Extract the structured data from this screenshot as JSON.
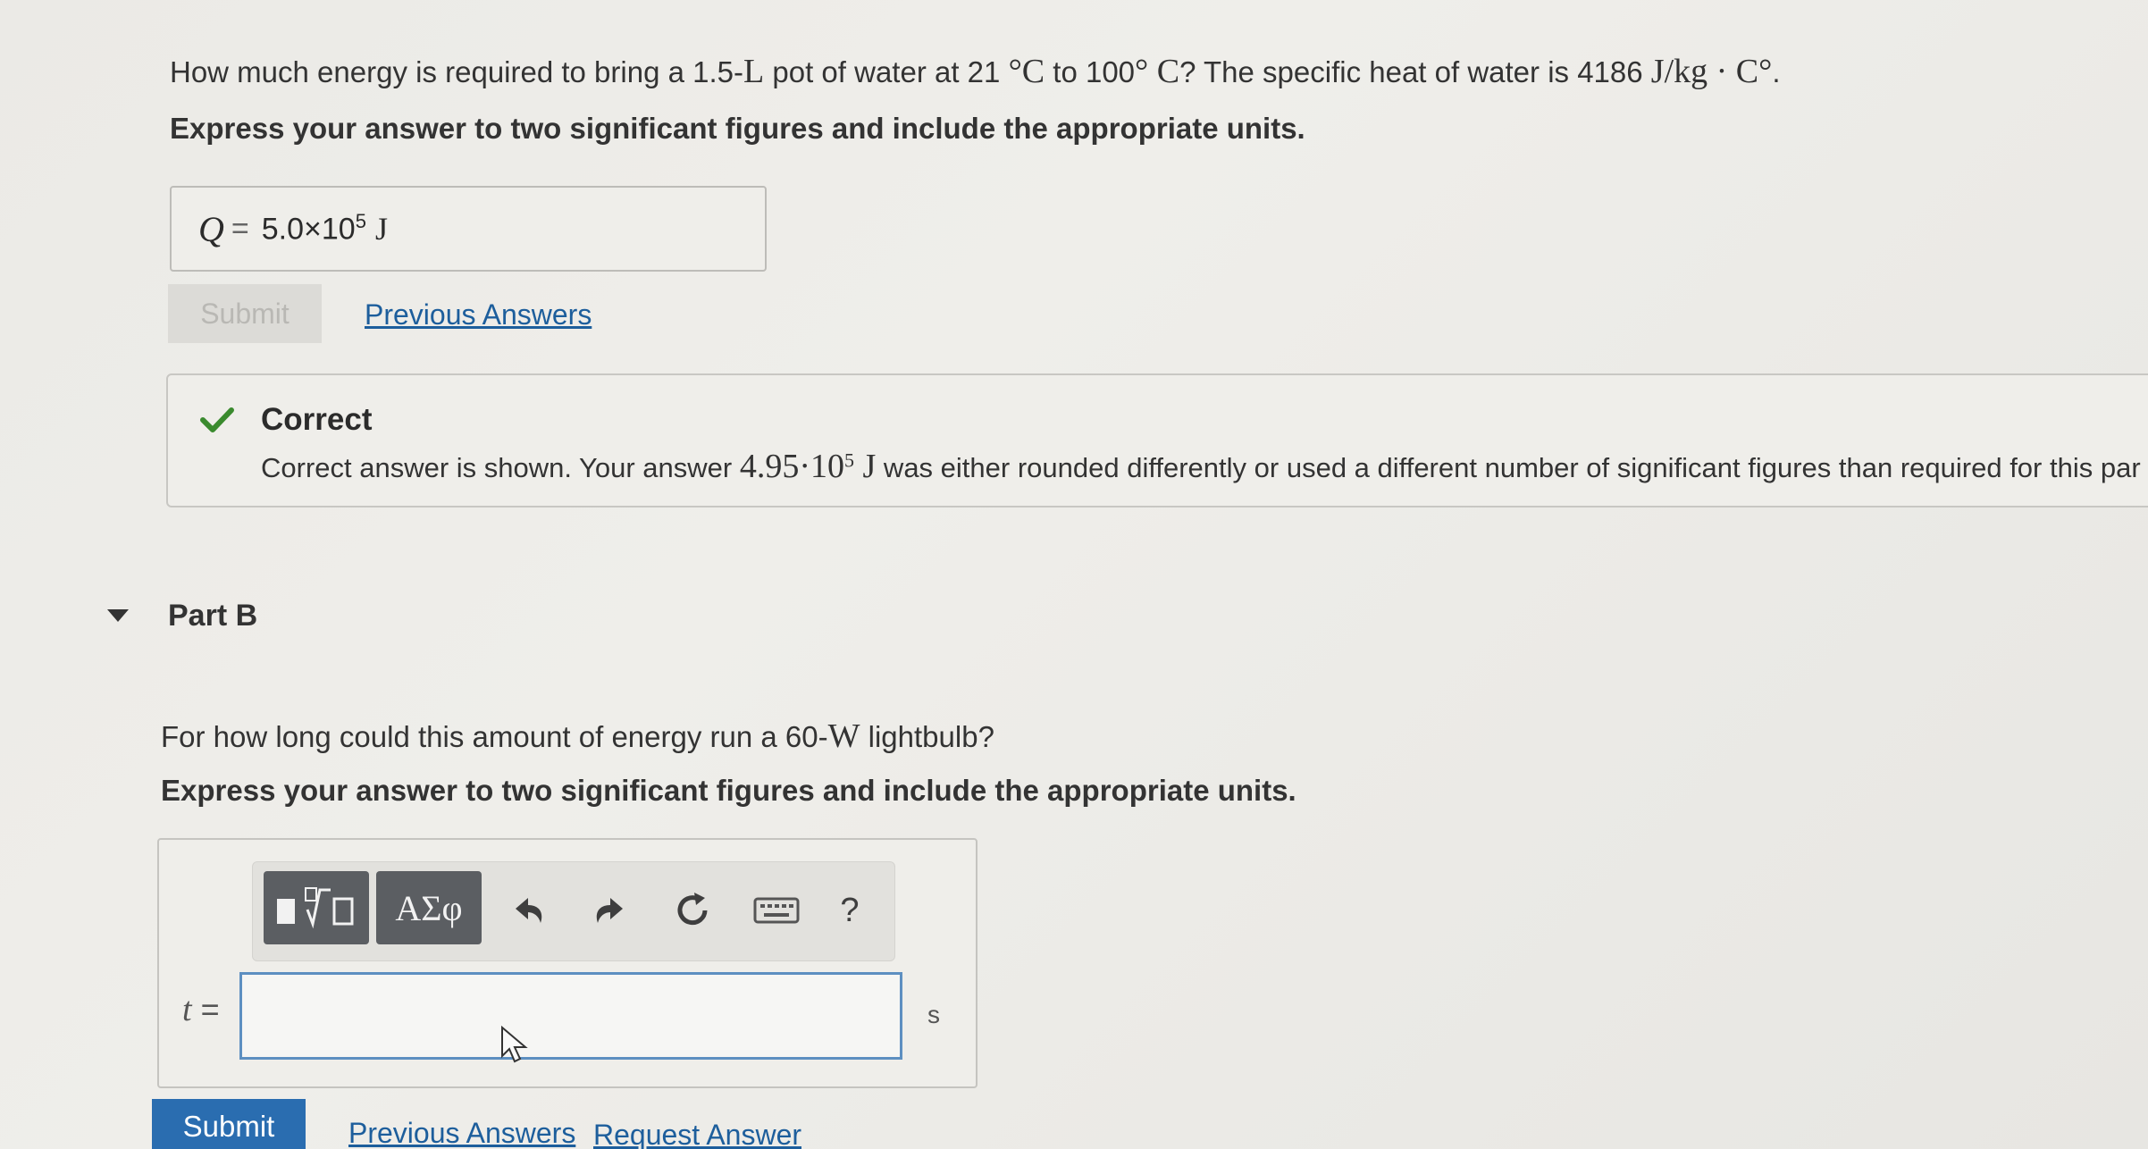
{
  "part_a": {
    "question_pre": "How much energy is required to bring a 1.5-",
    "question_L": "L",
    "question_mid1": " pot of water at 21 ",
    "question_deg1": "°C",
    "question_mid2": " to 100",
    "question_deg2": "° C",
    "question_mid3": "? The specific heat of water is 4186 ",
    "question_unit": "J/kg · C°",
    "question_end": ".",
    "instruction": "Express your answer to two significant figures and include the appropriate units.",
    "answer_var": "Q",
    "answer_eq": "=",
    "answer_mantissa": "5.0×10",
    "answer_exp": "5",
    "answer_unit": "J",
    "submit_label": "Submit",
    "previous_answers_label": "Previous Answers"
  },
  "feedback": {
    "title": "Correct",
    "text_pre": "Correct answer is shown. Your answer ",
    "text_value": "4.95·10",
    "text_exp": "5",
    "text_unit": " J",
    "text_post": " was either rounded differently or used a different number of significant figures than required for this par",
    "color": "#3a8a2e"
  },
  "part_b": {
    "title": "Part B",
    "question_pre": "For how long could this amount of energy run a 60-",
    "question_W": "W",
    "question_post": " lightbulb?",
    "instruction": "Express your answer to two significant figures and include the appropriate units.",
    "toolbar": {
      "greek_label": "ΑΣφ",
      "help_label": "?"
    },
    "var_label": "t",
    "var_eq": "=",
    "unit": "s",
    "submit_label": "Submit",
    "previous_answers_label": "Previous Answers",
    "request_answer_label": "Request Answer"
  },
  "colors": {
    "link": "#1d5e9c",
    "primary_button": "#2a6db0",
    "toolbar_button": "#5b5e62",
    "input_border": "#5d8fc1"
  }
}
